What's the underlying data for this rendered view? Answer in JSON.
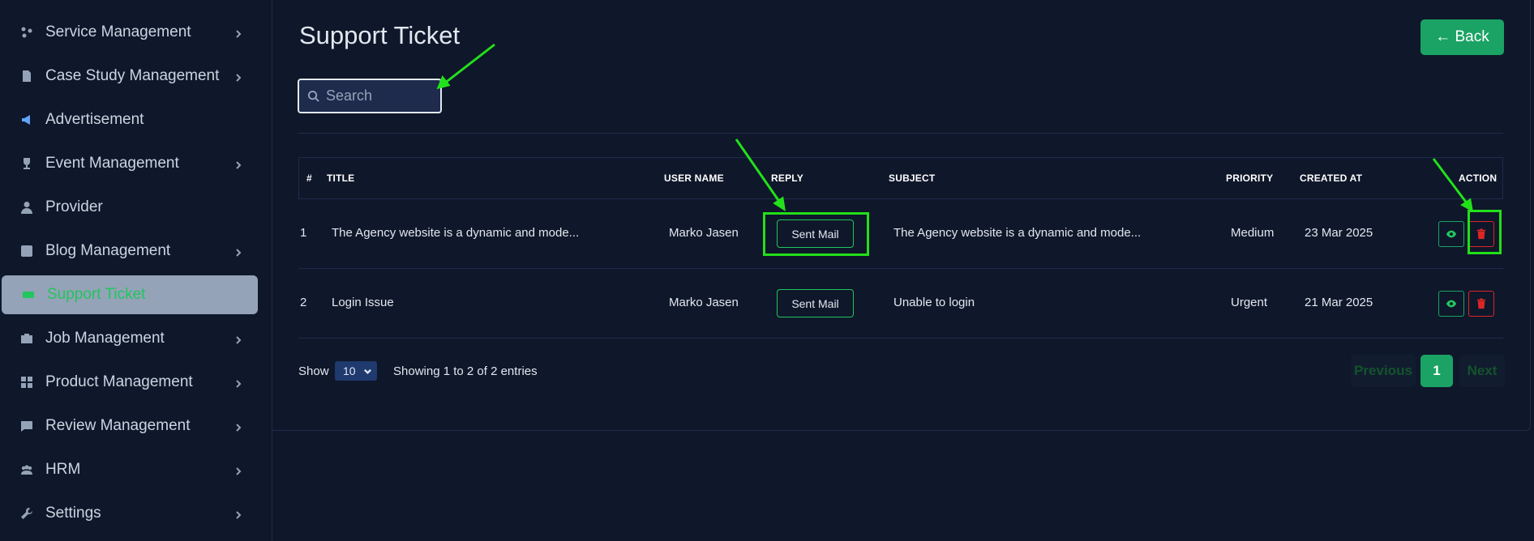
{
  "sidebar": {
    "items": [
      {
        "label": "Service Management",
        "icon": "service-icon",
        "has_submenu": true
      },
      {
        "label": "Case Study Management",
        "icon": "document-icon",
        "has_submenu": true
      },
      {
        "label": "Advertisement",
        "icon": "megaphone-icon",
        "has_submenu": false
      },
      {
        "label": "Event Management",
        "icon": "trophy-icon",
        "has_submenu": true
      },
      {
        "label": "Provider",
        "icon": "user-icon",
        "has_submenu": false
      },
      {
        "label": "Blog Management",
        "icon": "blog-icon",
        "has_submenu": true
      },
      {
        "label": "Support Ticket",
        "icon": "ticket-icon",
        "has_submenu": false,
        "active": true
      },
      {
        "label": "Job Management",
        "icon": "briefcase-icon",
        "has_submenu": true
      },
      {
        "label": "Product Management",
        "icon": "grid-icon",
        "has_submenu": true
      },
      {
        "label": "Review Management",
        "icon": "review-icon",
        "has_submenu": true
      },
      {
        "label": "HRM",
        "icon": "team-icon",
        "has_submenu": true
      },
      {
        "label": "Settings",
        "icon": "wrench-icon",
        "has_submenu": true
      }
    ]
  },
  "page": {
    "title": "Support Ticket",
    "back_label": "← Back"
  },
  "search": {
    "placeholder": "Search",
    "value": ""
  },
  "table": {
    "headers": [
      "#",
      "TITLE",
      "USER NAME",
      "REPLY",
      "SUBJECT",
      "PRIORITY",
      "CREATED AT",
      "ACTION"
    ],
    "rows": [
      {
        "index": "1",
        "title": "The Agency website is a dynamic and mode...",
        "user_name": "Marko Jasen",
        "reply": "Sent Mail",
        "subject": "The Agency website is a dynamic and mode...",
        "priority": "Medium",
        "created_at": "23 Mar 2025"
      },
      {
        "index": "2",
        "title": "Login Issue",
        "user_name": "Marko Jasen",
        "reply": "Sent Mail",
        "subject": "Unable to login",
        "priority": "Urgent",
        "created_at": "21 Mar 2025"
      }
    ]
  },
  "footer": {
    "show_label": "Show",
    "page_size": "10",
    "entries_info": "Showing 1 to 2 of 2 entries"
  },
  "pagination": {
    "previous": "Previous",
    "current": "1",
    "next": "Next"
  },
  "colors": {
    "background": "#0f172a",
    "accent_green": "#1aa364",
    "danger_red": "#dc2626",
    "annotation_green": "#22e01a"
  }
}
